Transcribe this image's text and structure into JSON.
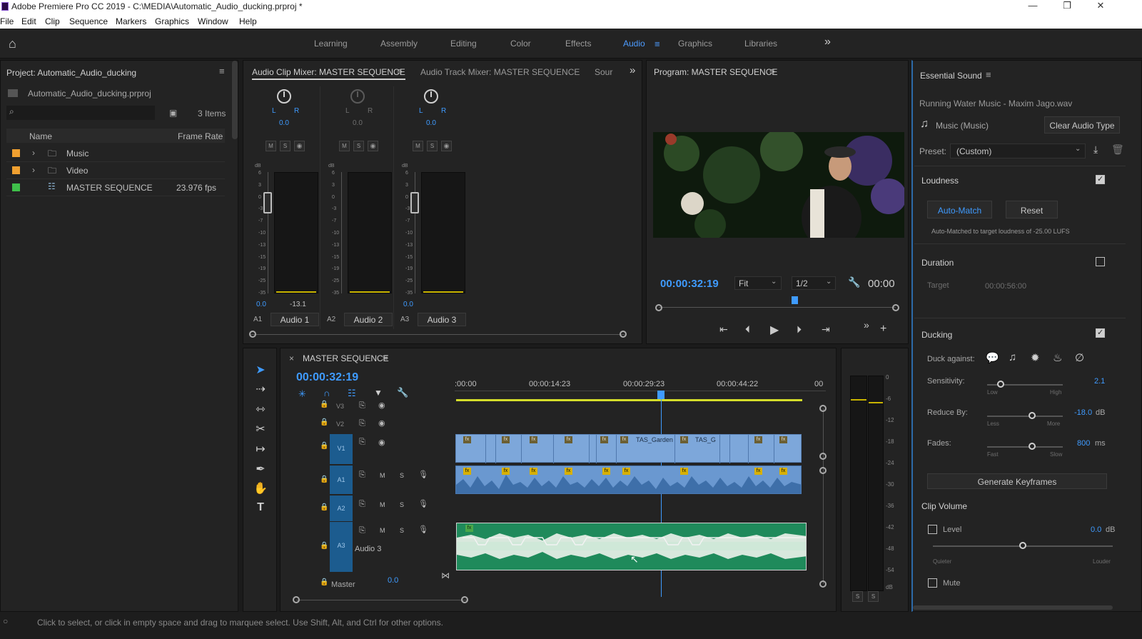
{
  "window": {
    "title": "Adobe Premiere Pro CC 2019 - C:\\MEDIA\\Automatic_Audio_ducking.prproj *",
    "minimize_icon": "minimize-icon",
    "maximize_icon": "restore-icon",
    "close_icon": "close-icon"
  },
  "menu": [
    "File",
    "Edit",
    "Clip",
    "Sequence",
    "Markers",
    "Graphics",
    "Window",
    "Help"
  ],
  "workspaces": {
    "tabs": [
      "Learning",
      "Assembly",
      "Editing",
      "Color",
      "Effects",
      "Audio",
      "Graphics",
      "Libraries"
    ],
    "active": "Audio",
    "overflow": "»"
  },
  "project": {
    "title": "Project: Automatic_Audio_ducking",
    "file": "Automatic_Audio_ducking.prproj",
    "items_count": "3 Items",
    "col_name": "Name",
    "col_rate": "Frame Rate",
    "rows": [
      {
        "name": "Music",
        "rate": "",
        "color": "#f0a030",
        "kind": "folder"
      },
      {
        "name": "Video",
        "rate": "",
        "color": "#f0a030",
        "kind": "folder"
      },
      {
        "name": "MASTER SEQUENCE",
        "rate": "23.976 fps",
        "color": "#3fbf4a",
        "kind": "sequence"
      }
    ]
  },
  "mixer": {
    "tabs": [
      "Audio Clip Mixer: MASTER SEQUENCE",
      "Audio Track Mixer: MASTER SEQUENCE",
      "Sour"
    ],
    "channels": [
      {
        "id": "A1",
        "name": "Audio 1",
        "lr": "L",
        "lr_r": "R",
        "pan": "0.0",
        "vol": "0.0",
        "peak": "-13.1",
        "enabled": true
      },
      {
        "id": "A2",
        "name": "Audio 2",
        "lr": "L",
        "lr_r": "R",
        "pan": "0.0",
        "vol": "",
        "peak": "",
        "enabled": false
      },
      {
        "id": "A3",
        "name": "Audio 3",
        "lr": "L",
        "lr_r": "R",
        "pan": "0.0",
        "vol": "0.0",
        "peak": "",
        "enabled": true
      }
    ],
    "msr": [
      "M",
      "S",
      "R"
    ],
    "db_label": "dB",
    "scale": [
      "6",
      "3",
      "0",
      "-3",
      "-7",
      "-10",
      "-13",
      "-15",
      "-19",
      "-25",
      "-35"
    ]
  },
  "program": {
    "title": "Program: MASTER SEQUENCE",
    "timecode": "00:00:32:19",
    "fit": "Fit",
    "resolution": "1/2",
    "duration": "00:00"
  },
  "timeline": {
    "title": "MASTER SEQUENCE",
    "timecode": "00:00:32:19",
    "ruler": [
      ":00:00",
      "00:00:14:23",
      "00:00:29:23",
      "00:00:44:22",
      "00"
    ],
    "tracks": [
      {
        "id": "V3",
        "type": "video",
        "name": ""
      },
      {
        "id": "V2",
        "type": "video",
        "name": ""
      },
      {
        "id": "V1",
        "type": "video",
        "name": ""
      },
      {
        "id": "A1",
        "type": "audio",
        "name": ""
      },
      {
        "id": "A2",
        "type": "audio",
        "name": ""
      },
      {
        "id": "A3",
        "type": "audio",
        "name": "Audio 3"
      }
    ],
    "master_label": "Master",
    "master_value": "0.0",
    "clip_labels": [
      "TAS_Garden",
      "TAS_G"
    ],
    "m": "M",
    "s": "S",
    "fx": "fx"
  },
  "meters": {
    "scale": [
      "0",
      "-6",
      "-12",
      "-18",
      "-24",
      "-30",
      "-36",
      "-42",
      "-48",
      "-54",
      "dB"
    ],
    "solo_left": "S",
    "solo_right": "S"
  },
  "essential_sound": {
    "title": "Essential Sound",
    "clip_name": "Running Water Music - Maxim Jago.wav",
    "type_label": "Music (Music)",
    "clear_button": "Clear Audio Type",
    "preset_label": "Preset:",
    "preset_value": "(Custom)",
    "loudness": {
      "label": "Loudness",
      "checked": true,
      "auto_match": "Auto-Match",
      "reset": "Reset",
      "note": "Auto-Matched to target loudness of -25.00 LUFS"
    },
    "duration": {
      "label": "Duration",
      "checked": false,
      "target_label": "Target",
      "target_value": "00:00:56:00"
    },
    "ducking": {
      "label": "Ducking",
      "checked": true,
      "duck_against": "Duck against:",
      "sensitivity": {
        "label": "Sensitivity:",
        "value": "2.1",
        "low": "Low",
        "high": "High",
        "level": 0.15
      },
      "reduce_by": {
        "label": "Reduce By:",
        "value": "-18.0",
        "unit": "dB",
        "less": "Less",
        "more": "More",
        "level": 0.6
      },
      "fades": {
        "label": "Fades:",
        "value": "800",
        "unit": "ms",
        "fast": "Fast",
        "slow": "Slow",
        "level": 0.6
      },
      "generate": "Generate Keyframes"
    },
    "clip_volume": {
      "label": "Clip Volume",
      "level_label": "Level",
      "level_value": "0.0",
      "unit": "dB",
      "quieter": "Quieter",
      "louder": "Louder",
      "mute_label": "Mute",
      "slider_level": 0.5
    }
  },
  "status": {
    "text": "Click to select, or click in empty space and drag to marquee select. Use Shift, Alt, and Ctrl for other options."
  }
}
